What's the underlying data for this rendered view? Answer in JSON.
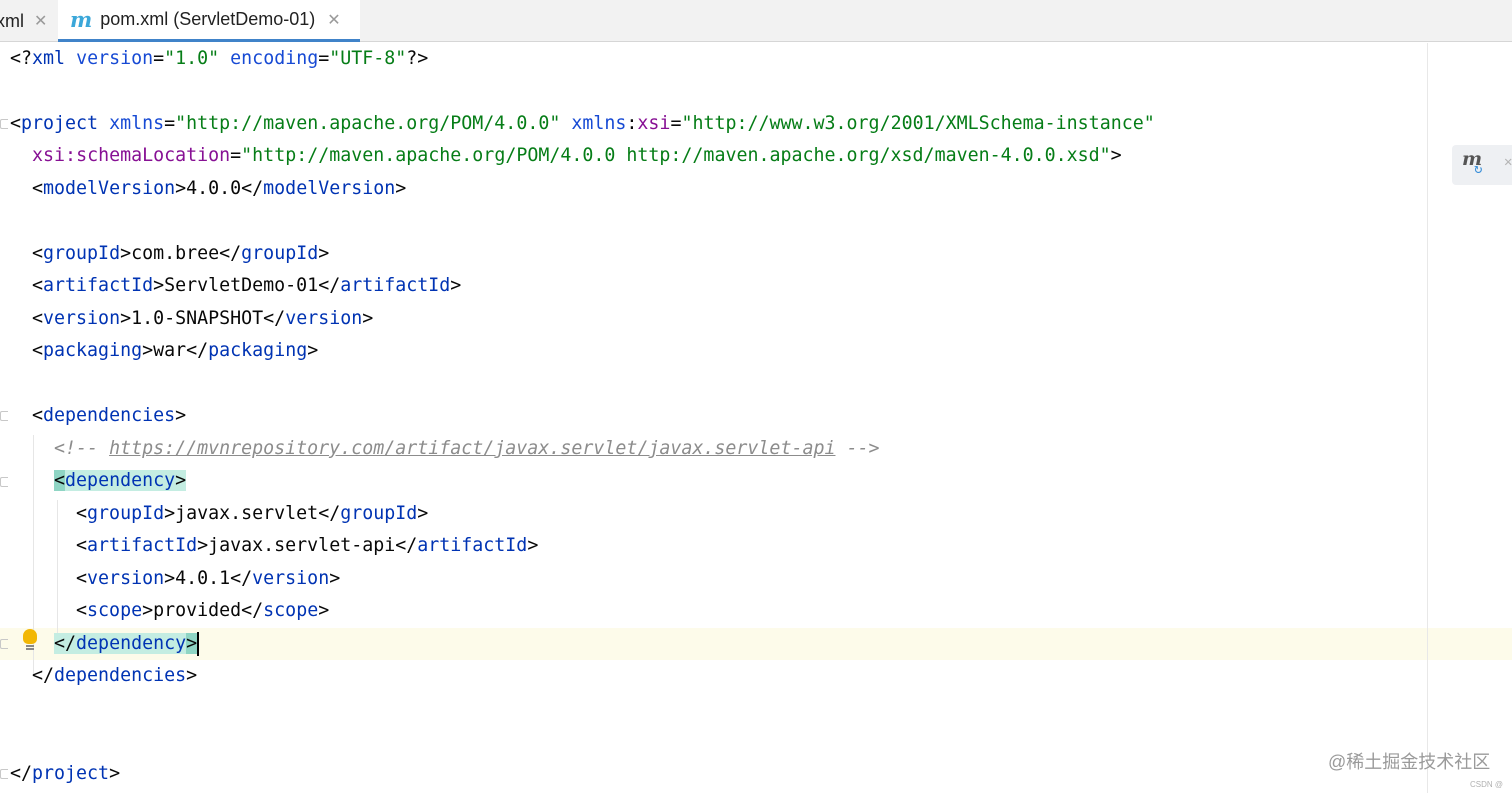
{
  "tabs": {
    "prev_label": "xml",
    "active_label": "pom.xml (ServletDemo-01)",
    "close_glyph": "✕",
    "active_icon_glyph": "m"
  },
  "code": {
    "decl": {
      "open": "<?",
      "name": "xml",
      "a1": "version",
      "v1": "\"1.0\"",
      "a2": "encoding",
      "v2": "\"UTF-8\"",
      "close": "?>"
    },
    "project": {
      "name": "project",
      "a1": "xmlns",
      "v1": "\"http://maven.apache.org/POM/4.0.0\"",
      "a2_prefix": "xmlns",
      "a2_local": "xsi",
      "v2": "\"http://www.w3.org/2001/XMLSchema-instance\"",
      "a3_prefix": "xsi",
      "a3_local": "schemaLocation",
      "v3": "\"http://maven.apache.org/POM/4.0.0 http://maven.apache.org/xsd/maven-4.0.0.xsd\""
    },
    "modelVersion": {
      "tag": "modelVersion",
      "value": "4.0.0"
    },
    "groupId": {
      "tag": "groupId",
      "value": "com.bree"
    },
    "artifactId": {
      "tag": "artifactId",
      "value": "ServletDemo-01"
    },
    "version": {
      "tag": "version",
      "value": "1.0-SNAPSHOT"
    },
    "packaging": {
      "tag": "packaging",
      "value": "war"
    },
    "dependencies_tag": "dependencies",
    "comment": {
      "open": "<!-- ",
      "url": "https://mvnrepository.com/artifact/javax.servlet/javax.servlet-api",
      "close": " -->"
    },
    "dependency_tag": "dependency",
    "dep_groupId": {
      "tag": "groupId",
      "value": "javax.servlet"
    },
    "dep_artifactId": {
      "tag": "artifactId",
      "value": "javax.servlet-api"
    },
    "dep_version": {
      "tag": "version",
      "value": "4.0.1"
    },
    "dep_scope": {
      "tag": "scope",
      "value": "provided"
    }
  },
  "watermark": {
    "text": "@稀土掘金技术社区",
    "small": "CSDN @"
  },
  "icons": [
    "maven-icon",
    "close-icon",
    "lightbulb-icon",
    "maven-reload-icon",
    "fold-marker-icon"
  ]
}
